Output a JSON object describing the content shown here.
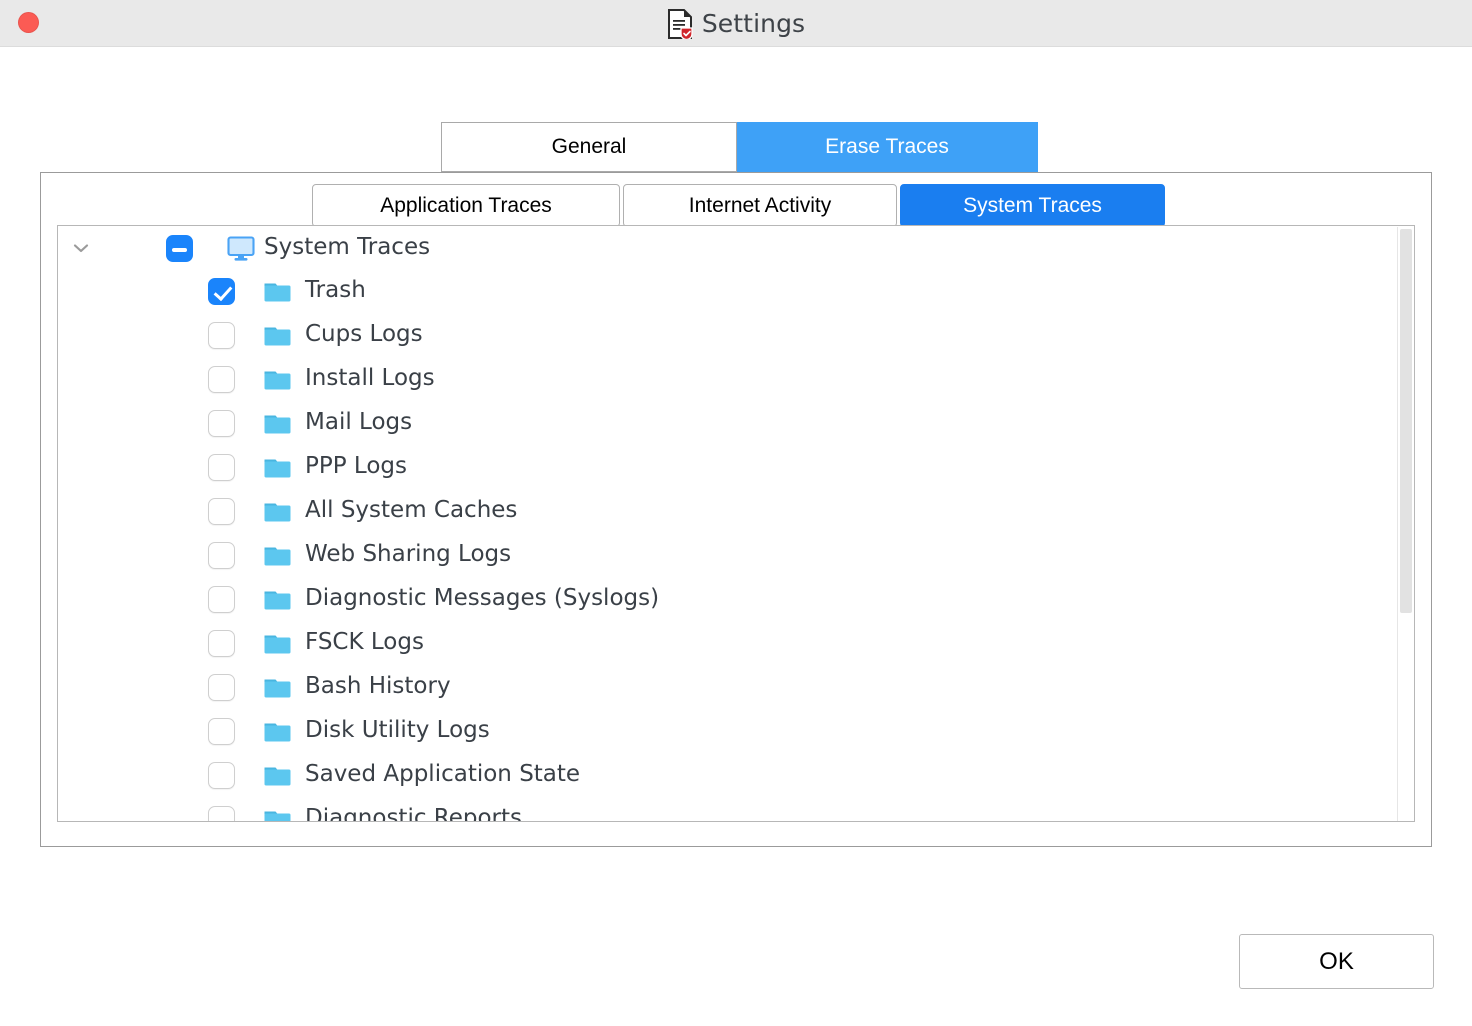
{
  "window": {
    "title": "Settings",
    "title_icon": "document-shield-icon",
    "close_button": "close-window-button",
    "titlebar_color": "#e9e9e9"
  },
  "outer_tabs": [
    {
      "label": "General",
      "active": false
    },
    {
      "label": "Erase Traces",
      "active": true
    }
  ],
  "inner_tabs": [
    {
      "label": "Application Traces",
      "active": false
    },
    {
      "label": "Internet Activity",
      "active": false
    },
    {
      "label": "System Traces",
      "active": true
    }
  ],
  "tree": {
    "root": {
      "label": "System Traces",
      "icon": "monitor-icon",
      "checkbox_state": "indeterminate",
      "expanded": true,
      "chevron": "chevron-down-icon"
    },
    "items": [
      {
        "label": "Trash",
        "icon": "folder-icon",
        "checked": true
      },
      {
        "label": "Cups Logs",
        "icon": "folder-icon",
        "checked": false
      },
      {
        "label": "Install Logs",
        "icon": "folder-icon",
        "checked": false
      },
      {
        "label": "Mail Logs",
        "icon": "folder-icon",
        "checked": false
      },
      {
        "label": "PPP Logs",
        "icon": "folder-icon",
        "checked": false
      },
      {
        "label": "All System Caches",
        "icon": "folder-icon",
        "checked": false
      },
      {
        "label": "Web Sharing Logs",
        "icon": "folder-icon",
        "checked": false
      },
      {
        "label": "Diagnostic Messages (Syslogs)",
        "icon": "folder-icon",
        "checked": false
      },
      {
        "label": "FSCK Logs",
        "icon": "folder-icon",
        "checked": false
      },
      {
        "label": "Bash History",
        "icon": "folder-icon",
        "checked": false
      },
      {
        "label": "Disk Utility Logs",
        "icon": "folder-icon",
        "checked": false
      },
      {
        "label": "Saved Application State",
        "icon": "folder-icon",
        "checked": false
      },
      {
        "label": "Diagnostic Reports",
        "icon": "folder-icon",
        "checked": false
      }
    ]
  },
  "scrollbar": {
    "orientation": "vertical",
    "thumb_position_percent": 0,
    "thumb_size_percent": 65
  },
  "footer": {
    "ok_label": "OK"
  },
  "colors": {
    "accent_blue": "#1a84fb",
    "tab_active_blue": "#1a7ef0",
    "outer_tab_active_blue": "#3ea1f7",
    "folder_blue": "#5cc7ef",
    "close_red": "#fb5b54",
    "text_dark": "#3a4047"
  }
}
